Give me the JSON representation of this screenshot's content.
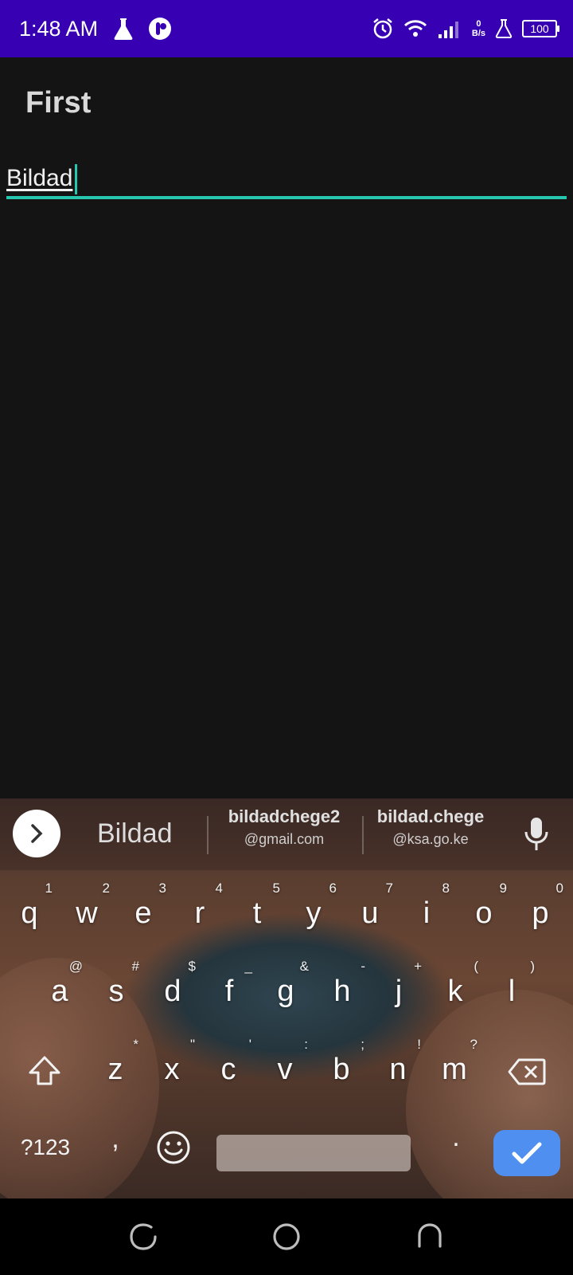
{
  "status_bar": {
    "time": "1:48 AM",
    "left_icons": [
      "flask-icon",
      "pill-icon"
    ],
    "right_icons": [
      "alarm-icon",
      "wifi-icon",
      "signal-icon",
      "flask-icon"
    ],
    "net_speed_value": "0",
    "net_speed_unit": "B/s",
    "battery_level": "100"
  },
  "app": {
    "title": "First",
    "name_input_value": "Bildad"
  },
  "keyboard": {
    "suggestions": {
      "main": "Bildad",
      "s2_line1": "bildadchege2",
      "s2_line2": "@gmail.com",
      "s3_line1": "bildad.chege",
      "s3_line2": "@ksa.go.ke"
    },
    "row1": [
      {
        "k": "q",
        "s": "1"
      },
      {
        "k": "w",
        "s": "2"
      },
      {
        "k": "e",
        "s": "3"
      },
      {
        "k": "r",
        "s": "4"
      },
      {
        "k": "t",
        "s": "5"
      },
      {
        "k": "y",
        "s": "6"
      },
      {
        "k": "u",
        "s": "7"
      },
      {
        "k": "i",
        "s": "8"
      },
      {
        "k": "o",
        "s": "9"
      },
      {
        "k": "p",
        "s": "0"
      }
    ],
    "row2": [
      {
        "k": "a",
        "s": "@"
      },
      {
        "k": "s",
        "s": "#"
      },
      {
        "k": "d",
        "s": "$"
      },
      {
        "k": "f",
        "s": "_"
      },
      {
        "k": "g",
        "s": "&"
      },
      {
        "k": "h",
        "s": "-"
      },
      {
        "k": "j",
        "s": "+"
      },
      {
        "k": "k",
        "s": "("
      },
      {
        "k": "l",
        "s": ")"
      }
    ],
    "row3": [
      {
        "k": "z",
        "s": "*"
      },
      {
        "k": "x",
        "s": "\""
      },
      {
        "k": "c",
        "s": "'"
      },
      {
        "k": "v",
        "s": ":"
      },
      {
        "k": "b",
        "s": ";"
      },
      {
        "k": "n",
        "s": "!"
      },
      {
        "k": "m",
        "s": "?"
      }
    ],
    "symbols_label": "?123",
    "comma_label": ",",
    "period_label": "."
  },
  "nav_bar": {
    "icons": [
      "recents-icon",
      "home-icon",
      "back-icon"
    ]
  },
  "colors": {
    "status_bar": "#3700b3",
    "accent": "#26c6b0",
    "enter_key": "#4f8ff0"
  }
}
